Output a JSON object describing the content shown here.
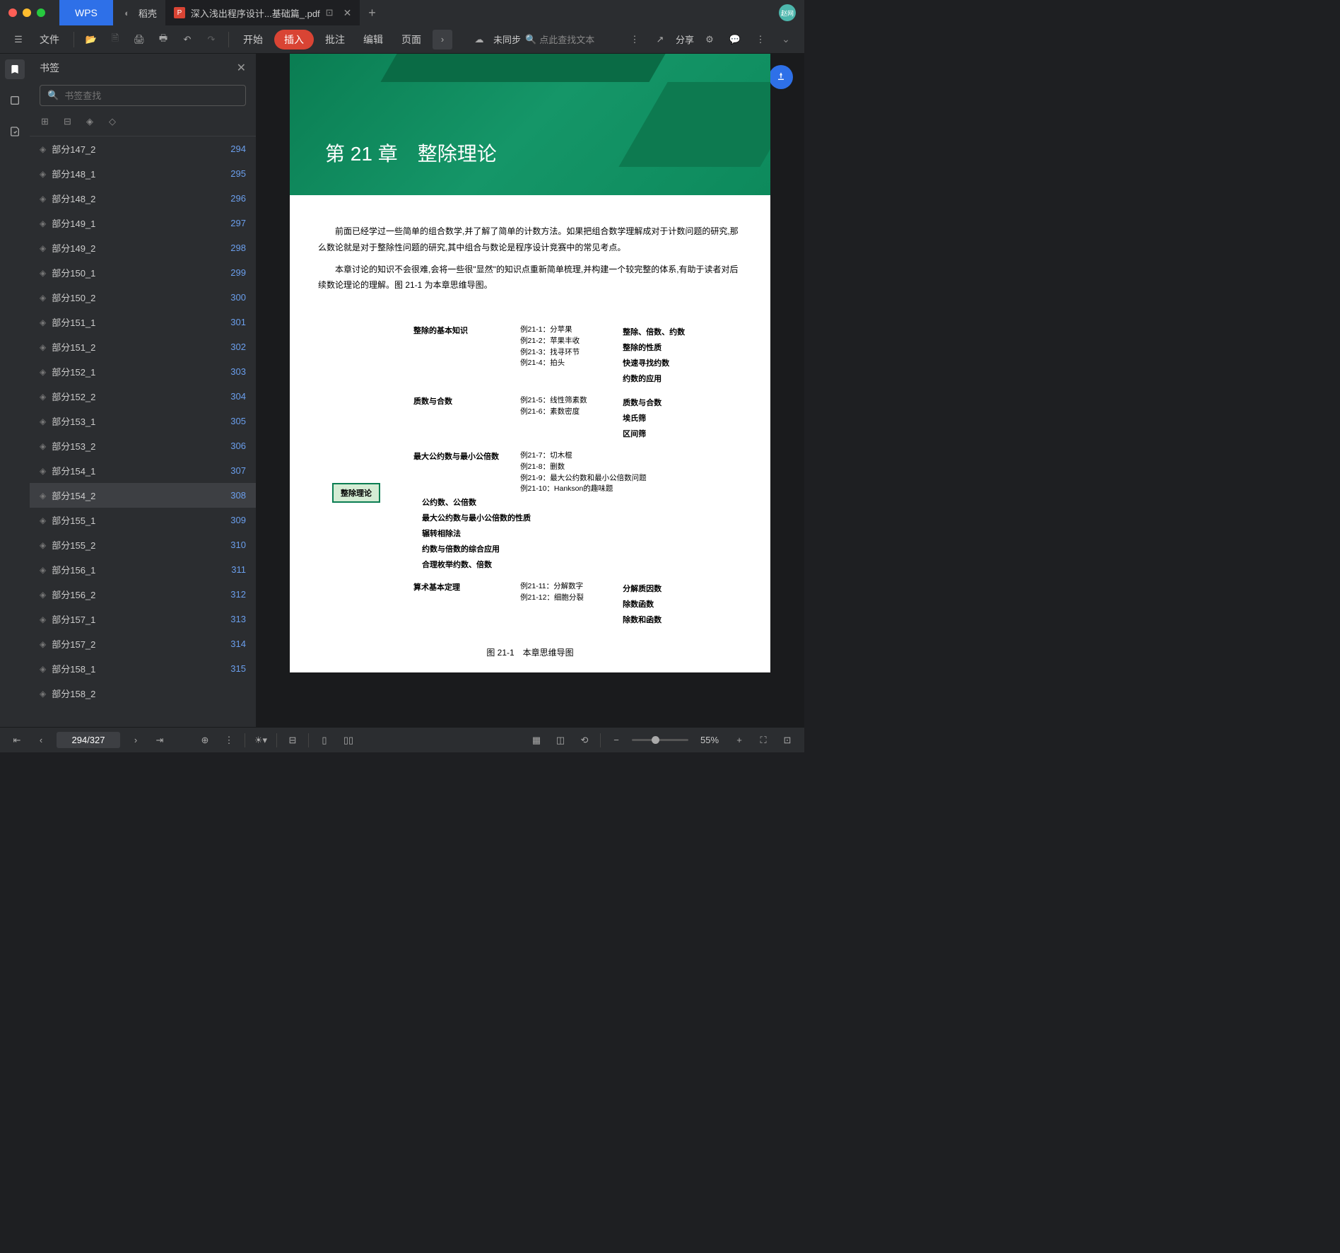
{
  "titlebar": {
    "wps": "WPS",
    "tab1": "稻壳",
    "tab2": "深入浅出程序设计...基础篇_.pdf",
    "avatar": "赵网"
  },
  "toolbar": {
    "file": "文件",
    "start": "开始",
    "insert": "插入",
    "comment": "批注",
    "edit": "编辑",
    "page": "页面",
    "unsync": "未同步",
    "search_placeholder": "点此查找文本",
    "share": "分享"
  },
  "bookmarks": {
    "title": "书签",
    "search_placeholder": "书签查找",
    "items": [
      {
        "label": "部分147_2",
        "page": "294"
      },
      {
        "label": "部分148_1",
        "page": "295"
      },
      {
        "label": "部分148_2",
        "page": "296"
      },
      {
        "label": "部分149_1",
        "page": "297"
      },
      {
        "label": "部分149_2",
        "page": "298"
      },
      {
        "label": "部分150_1",
        "page": "299"
      },
      {
        "label": "部分150_2",
        "page": "300"
      },
      {
        "label": "部分151_1",
        "page": "301"
      },
      {
        "label": "部分151_2",
        "page": "302"
      },
      {
        "label": "部分152_1",
        "page": "303"
      },
      {
        "label": "部分152_2",
        "page": "304"
      },
      {
        "label": "部分153_1",
        "page": "305"
      },
      {
        "label": "部分153_2",
        "page": "306"
      },
      {
        "label": "部分154_1",
        "page": "307"
      },
      {
        "label": "部分154_2",
        "page": "308"
      },
      {
        "label": "部分155_1",
        "page": "309"
      },
      {
        "label": "部分155_2",
        "page": "310"
      },
      {
        "label": "部分156_1",
        "page": "311"
      },
      {
        "label": "部分156_2",
        "page": "312"
      },
      {
        "label": "部分157_1",
        "page": "313"
      },
      {
        "label": "部分157_2",
        "page": "314"
      },
      {
        "label": "部分158_1",
        "page": "315"
      },
      {
        "label": "部分158_2",
        "page": ""
      }
    ],
    "selected_index": 14
  },
  "pdf": {
    "chapter": "第 21 章　整除理论",
    "para1": "前面已经学过一些简单的组合数学,并了解了简单的计数方法。如果把组合数学理解成对于计数问题的研究,那么数论就是对于整除性问题的研究,其中组合与数论是程序设计竞赛中的常见考点。",
    "para2": "本章讨论的知识不会很难,会将一些很\"显然\"的知识点重新简单梳理,并构建一个较完整的体系,有助于读者对后续数论理论的理解。图 21-1 为本章思维导图。",
    "mindmap": {
      "root": "整除理论",
      "branches": [
        {
          "title": "整除的基本知识",
          "examples": [
            "例21-1：分苹果",
            "例21-2：苹果丰收",
            "例21-3：找寻环节",
            "例21-4：拍头"
          ],
          "leaves": [
            "整除、倍数、约数",
            "整除的性质",
            "快速寻找约数",
            "约数的应用"
          ]
        },
        {
          "title": "质数与合数",
          "examples": [
            "例21-5：线性筛素数",
            "例21-6：素数密度"
          ],
          "leaves": [
            "质数与合数",
            "埃氏筛",
            "区间筛"
          ]
        },
        {
          "title": "最大公约数与最小公倍数",
          "examples": [
            "例21-7：切木棍",
            "例21-8：删数",
            "例21-9：最大公约数和最小公倍数问题",
            "例21-10：Hankson的趣味题"
          ],
          "leaves": [
            "公约数、公倍数",
            "最大公约数与最小公倍数的性质",
            "辗转相除法",
            "约数与倍数的综合应用",
            "合理枚举约数、倍数"
          ]
        },
        {
          "title": "算术基本定理",
          "examples": [
            "例21-11：分解数字",
            "例21-12：细胞分裂"
          ],
          "leaves": [
            "分解质因数",
            "除数函数",
            "除数和函数"
          ]
        }
      ],
      "caption": "图 21-1　本章思维导图"
    }
  },
  "statusbar": {
    "page_indicator": "294/327",
    "zoom": "55%"
  }
}
